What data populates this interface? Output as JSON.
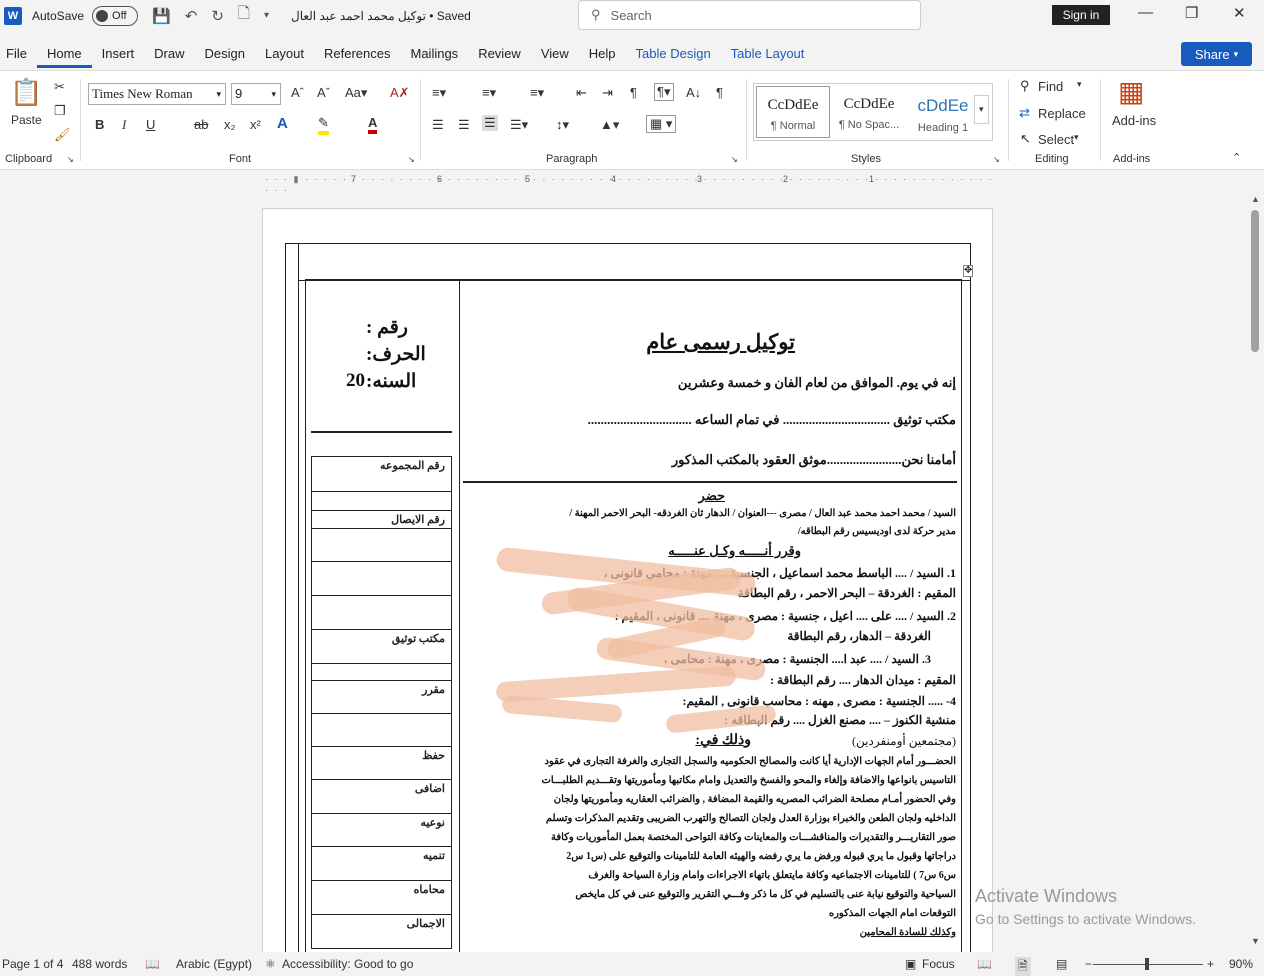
{
  "titlebar": {
    "autosave_label": "AutoSave",
    "autosave_state": "Off",
    "doc_title": "توكيل محمد احمد عبد العال • Saved",
    "search_placeholder": "Search",
    "signin_label": "Sign in"
  },
  "menu": {
    "tabs": [
      "File",
      "Home",
      "Insert",
      "Draw",
      "Design",
      "Layout",
      "References",
      "Mailings",
      "Review",
      "View",
      "Help",
      "Table Design",
      "Table Layout"
    ],
    "active": "Home",
    "share_label": "Share"
  },
  "ribbon": {
    "paste_label": "Paste",
    "font_name": "Times New Roman",
    "font_size": "9",
    "groups": {
      "clipboard": "Clipboard",
      "font": "Font",
      "paragraph": "Paragraph",
      "styles": "Styles",
      "editing": "Editing",
      "addins": "Add-ins"
    },
    "styles": [
      {
        "preview": "CcDdEe",
        "name": "¶ Normal"
      },
      {
        "preview": "CcDdEe",
        "name": "¶ No Spac..."
      },
      {
        "preview": "cDdEe",
        "name": "Heading 1"
      }
    ],
    "find_label": "Find",
    "replace_label": "Replace",
    "select_label": "Select",
    "addins_label": "Add-ins"
  },
  "ruler": {
    "numbers": [
      "7",
      "6",
      "5",
      "4",
      "3",
      "2",
      "1"
    ]
  },
  "document": {
    "left_header": {
      "number_label": "رقم :",
      "letter_label": "الحرف:",
      "year_label": "السنه:",
      "year_value": "20"
    },
    "left_rows": [
      {
        "label": "رقم المجموعه"
      },
      {
        "label": ""
      },
      {
        "label": "رقم الايصال"
      },
      {
        "label": ""
      },
      {
        "label": ""
      },
      {
        "label": ""
      },
      {
        "label": "مكتب توثيق"
      },
      {
        "label": ""
      },
      {
        "label": "مقرر"
      },
      {
        "label": ""
      },
      {
        "label": "حفظ"
      },
      {
        "label": "اضافى"
      },
      {
        "label": "نوعيه"
      },
      {
        "label": "تنميه"
      },
      {
        "label": "محاماه"
      },
      {
        "label": "الاجمالى"
      }
    ],
    "title": "توكيل رسمى عام",
    "line1": "إنه في يوم.              الموافق              من               لعام الفان و خمسة وعشرين",
    "line2": "مكتب توثيق .................................  في تمام الساعه  ................................",
    "line3": "أمامنا نحن.......................موثق العقود بالمكتب المذكور",
    "hadar": "حضر",
    "person1": "السيد / محمد احمد محمد عبد العال   / مصرى ---العنوان / الدهار ثان الغردقه- البحر الاحمر   المهنة /",
    "person1b": "مدير حركة لدى اوديسيس رقم البطاقه/",
    "waqarr": "وقرر  أنـــــه  وكـل  عنـــــه",
    "agent1": "1.  السيد / .... الباسط محمد اسماعيل ، الجنسية .... مهنة : محامي قانونى ،",
    "agent1b": "المقيم : الغردقة – البحر الاحمر ، رقم البطاقة",
    "agent2": "2.  السيد / .... على .... اعيل ، جنسية : مصرى ، مهنة .... قانونى ، المقيم :",
    "agent2b": "الغردقة – الدهار، رقم البطاقة",
    "agent3": "3.  السيد / .... عبد ا.... الجنسية : مصرى ، مهنة :  محامى ،",
    "agent3b": "المقيم : ميدان الدهار .... رقم البطاقة :",
    "agent4": "4- ..... الجنسية : مصرى , مهنه : محاسب قانونى , المقيم:",
    "agent4b": "منشية الكنوز – .... مصنع الغزل .... رقم البطاقه :",
    "together": "(مجتمعين أومنفردين)",
    "wadhalik": "وذلك في:",
    "body": [
      "الحضـــور أمام الجهات الإدارية أيا كانت والمصالح الحكوميه   والسجل التجارى والغرفة التجارى  في عقود",
      "التاسيس بانواعها والاضافة وإلغاء والمحو والفسخ  والتعديل وامام مكاتبها ومأموريتها وتقـــديم الطلبـــات",
      "وفي الحضور أمـام مصلحة الضرائب المصريه والقيمة المضافة , والضرائب العقاريه   ومأموريتها ولجان",
      "الداخليه ولجان الطعن  والخبراء بوزارة العدل ولجان التصالح والتهرب الضريبى وتقديم المذكرات  وتسلم",
      "صور  التقاريـــر والتقديرات والمناقشـــات والمعاينات وكافة التواحى المختصة بعمل المأموريات وكافة",
      "دراجاتها  وقبول ما يري قبوله ورفض ما يري رفضه  والهيئه العامة للتامينات  والتوقيع على (س1 س2",
      "س6 س7 ) للتامينات الاجتماعيه  وكافة مايتعلق باتهاء الاجراءات    وامام وزارة السياحة  والغرف",
      "السياحية   والتوقيع نيابة عنى بالتسليم في كل ما ذكر وفـــي التقرير والتوقيع  عنى في كل مايخص",
      "التوقعات امام الجهات المذكوره"
    ],
    "lawyers": "وكذلك للسادة المحامين"
  },
  "watermark": {
    "line1": "Activate Windows",
    "line2": "Go to Settings to activate Windows."
  },
  "status": {
    "page": "Page 1 of 4",
    "words": "488 words",
    "language": "Arabic (Egypt)",
    "accessibility": "Accessibility: Good to go",
    "focus": "Focus",
    "zoom": "90%"
  }
}
